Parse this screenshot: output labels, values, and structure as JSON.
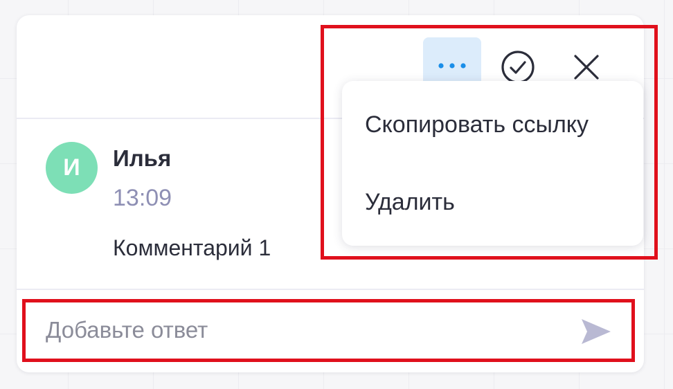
{
  "comment_thread": {
    "header": {
      "more_button_icon": "more-dots-icon",
      "resolve_button_icon": "check-circle-icon",
      "close_button_icon": "close-icon"
    },
    "comment": {
      "avatar_initial": "И",
      "avatar_color": "#7ddfb6",
      "author": "Илья",
      "time": "13:09",
      "text": "Комментарий 1"
    },
    "reply": {
      "placeholder": "Добавьте ответ",
      "value": "",
      "send_icon": "send-icon"
    }
  },
  "context_menu": {
    "items": [
      {
        "label": "Скопировать ссылку"
      },
      {
        "label": "Удалить"
      }
    ]
  },
  "colors": {
    "accent": "#1a8ee8",
    "more_button_bg": "#dcecfb",
    "time_text": "#8e8fb4",
    "send_icon": "#b9b9d3",
    "annotation_outline": "#e0101c"
  }
}
